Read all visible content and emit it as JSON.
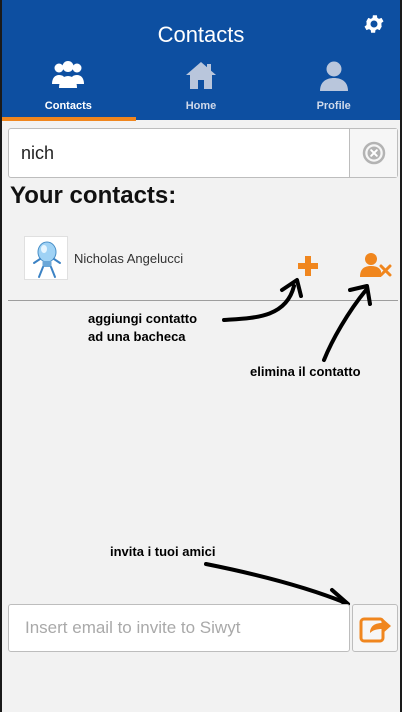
{
  "header": {
    "title": "Contacts",
    "settings_icon": "gear-icon"
  },
  "tabs": [
    {
      "label": "Contacts",
      "icon": "users-icon",
      "active": true
    },
    {
      "label": "Home",
      "icon": "home-icon",
      "active": false
    },
    {
      "label": "Profile",
      "icon": "user-icon",
      "active": false
    }
  ],
  "search": {
    "value": "nich",
    "clear_icon": "clear-circle-icon"
  },
  "contacts_section": {
    "title": "Your contacts:",
    "items": [
      {
        "name": "Nicholas Angelucci",
        "avatar_icon": "lightbulb-avatar",
        "add_icon": "plus-icon",
        "remove_icon": "remove-user-icon"
      }
    ]
  },
  "annotations": {
    "add_note_line1": "aggiungi contatto",
    "add_note_line2": "ad una bacheca",
    "remove_note": "elimina il contatto",
    "invite_note": "invita i tuoi amici"
  },
  "invite": {
    "placeholder": "Insert email to invite to Siwyt",
    "button_icon": "share-icon"
  },
  "colors": {
    "header_blue": "#0d4fa1",
    "accent_orange": "#f0861e"
  }
}
